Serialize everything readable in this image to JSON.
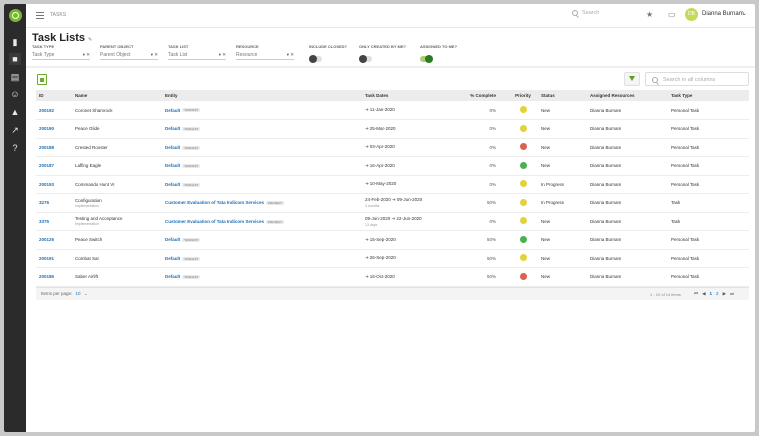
{
  "breadcrumb": "TASKS",
  "search": {
    "placeholder": "Search"
  },
  "user": {
    "initials": "DB",
    "name": "Dianna Burnam"
  },
  "page": {
    "title": "Task Lists"
  },
  "filters": [
    {
      "label": "TASK TYPE",
      "value": "Task Type",
      "controls": "▾ ✕"
    },
    {
      "label": "PARENT OBJECT",
      "value": "Parent Object",
      "controls": "▾ ✕"
    },
    {
      "label": "TASK LIST",
      "value": "Task List",
      "controls": "▾ ✕"
    },
    {
      "label": "RESOURCE",
      "value": "Resource",
      "controls": "▾ ✕"
    }
  ],
  "toggles": [
    {
      "label": "INCLUDE CLOSED?",
      "on": false
    },
    {
      "label": "ONLY CREATED BY ME?",
      "on": false
    },
    {
      "label": "ASSIGNED TO ME?",
      "on": true
    }
  ],
  "column_search": {
    "placeholder": "Search in all columns"
  },
  "colors": {
    "green": "#4caf50",
    "yellow": "#e3d23a",
    "red": "#e0604e",
    "link": "#1f6fb5",
    "accent": "#6dab2b"
  },
  "table": {
    "columns": [
      "ID",
      "Name",
      "Entity",
      "Task Dates",
      "% Complete",
      "Priority",
      "Status",
      "Assigned Resources",
      "Task Type"
    ],
    "rows": [
      {
        "id": "200192",
        "name": "Coronet Shamrock",
        "sub": "",
        "entity": "Default",
        "badge": "TASKLIST",
        "date_start": "",
        "date_end": "11-Jan-2020",
        "dur": "",
        "pct": "0%",
        "priority": "yellow",
        "status": "New",
        "resource": "Dianna Burnam",
        "type": "Personal Task"
      },
      {
        "id": "200190",
        "name": "Peace Glide",
        "sub": "",
        "entity": "Default",
        "badge": "TASKLIST",
        "date_start": "",
        "date_end": "25-Mar-2020",
        "dur": "",
        "pct": "0%",
        "priority": "yellow",
        "status": "New",
        "resource": "Dianna Burnam",
        "type": "Personal Task"
      },
      {
        "id": "200188",
        "name": "Crested Rooster",
        "sub": "",
        "entity": "Default",
        "badge": "TASKLIST",
        "date_start": "",
        "date_end": "03-Apr-2020",
        "dur": "",
        "pct": "0%",
        "priority": "red",
        "status": "New",
        "resource": "Dianna Burnam",
        "type": "Personal Task"
      },
      {
        "id": "200187",
        "name": "Laffing Eagle",
        "sub": "",
        "entity": "Default",
        "badge": "TASKLIST",
        "date_start": "",
        "date_end": "16-Apr-2020",
        "dur": "",
        "pct": "0%",
        "priority": "green",
        "status": "New",
        "resource": "Dianna Burnam",
        "type": "Personal Task"
      },
      {
        "id": "200193",
        "name": "Commando Hunt VI",
        "sub": "",
        "entity": "Default",
        "badge": "TASKLIST",
        "date_start": "",
        "date_end": "10-May-2020",
        "dur": "",
        "pct": "0%",
        "priority": "yellow",
        "status": "In Progress",
        "resource": "Dianna Burnam",
        "type": "Personal Task"
      },
      {
        "id": "3276",
        "name": "Configuration",
        "sub": "Implementation",
        "entity": "Customer Evaluation of Tata Indicom Services",
        "badge": "PROJECT",
        "date_start": "24-Feb-2020",
        "date_end": "09-Jun-2020",
        "dur": "3 months",
        "pct": "50%",
        "priority": "yellow",
        "status": "In Progress",
        "resource": "Dianna Burnam",
        "type": "Task"
      },
      {
        "id": "3375",
        "name": "Testing and Acceptance",
        "sub": "Implementation",
        "entity": "Customer Evaluation of Tata Indicom Services",
        "badge": "PROJECT",
        "date_start": "09-Jun-2020",
        "date_end": "22-Jun-2020",
        "dur": "13 days",
        "pct": "0%",
        "priority": "yellow",
        "status": "New",
        "resource": "Dianna Burnam",
        "type": "Task"
      },
      {
        "id": "200126",
        "name": "Peace Switch",
        "sub": "",
        "entity": "Default",
        "badge": "TASKLIST",
        "date_start": "",
        "date_end": "15-Sep-2020",
        "dur": "",
        "pct": "50%",
        "priority": "green",
        "status": "New",
        "resource": "Dianna Burnam",
        "type": "Personal Task"
      },
      {
        "id": "200191",
        "name": "Combat Sar",
        "sub": "",
        "entity": "Default",
        "badge": "TASKLIST",
        "date_start": "",
        "date_end": "26-Sep-2020",
        "dur": "",
        "pct": "50%",
        "priority": "yellow",
        "status": "New",
        "resource": "Dianna Burnam",
        "type": "Personal Task"
      },
      {
        "id": "200186",
        "name": "Saber Airlift",
        "sub": "",
        "entity": "Default",
        "badge": "TASKLIST",
        "date_start": "",
        "date_end": "16-Oct-2020",
        "dur": "",
        "pct": "50%",
        "priority": "red",
        "status": "New",
        "resource": "Dianna Burnam",
        "type": "Personal Task"
      }
    ]
  },
  "footer": {
    "per_page_label": "Items per page:",
    "per_page": "10",
    "range": "1 - 10 of 14 items",
    "pages": [
      "1",
      "2"
    ]
  }
}
